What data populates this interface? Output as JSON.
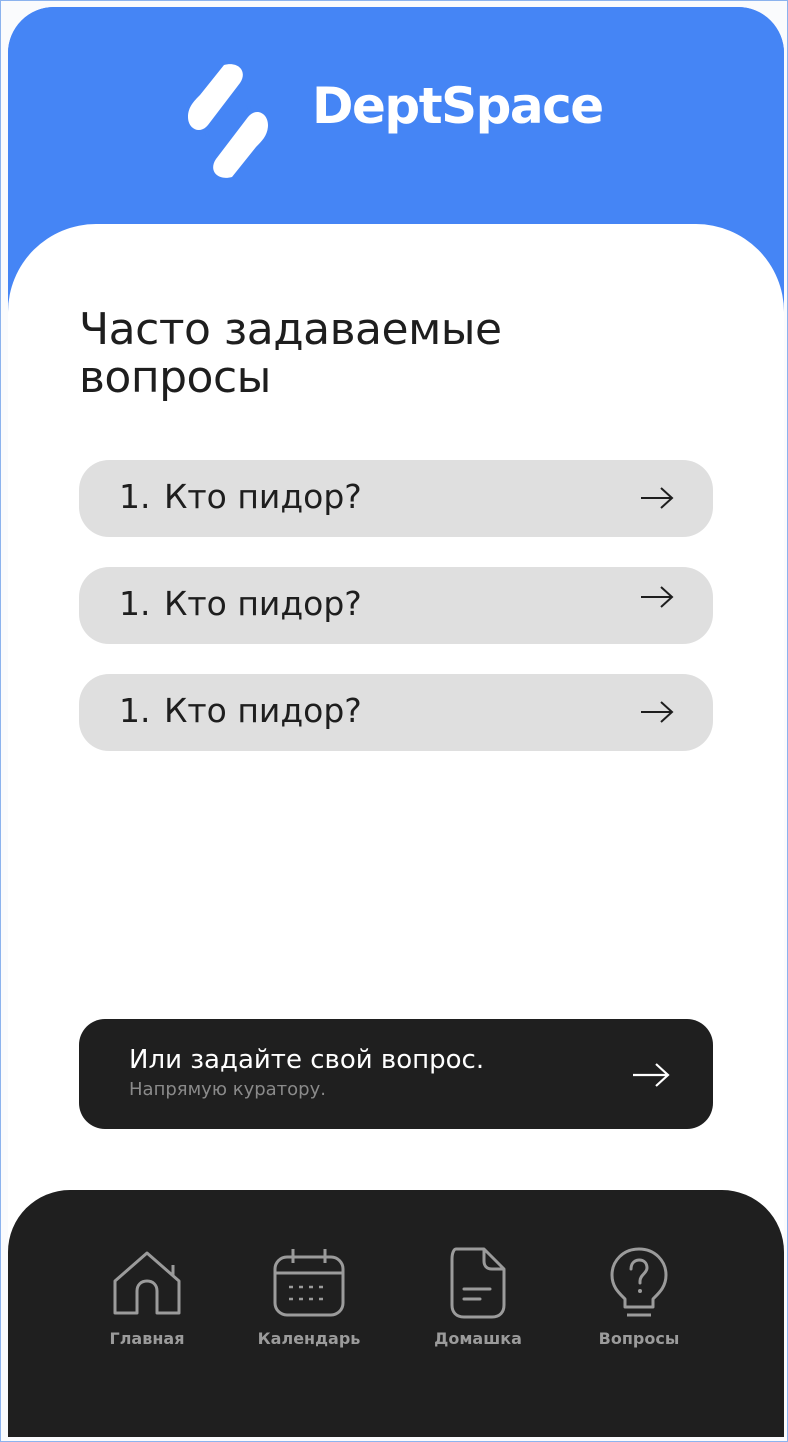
{
  "app": {
    "brand_name": "DeptSpace",
    "logo_icon": "deptspace-logo-icon",
    "accent_color": "#4585f5",
    "dark_color": "#1f1f1f"
  },
  "page": {
    "title": "Часто задаваемые вопросы"
  },
  "faq": {
    "items": [
      {
        "number": "1.",
        "question": "Кто пидор?",
        "icon": "arrow-right-icon"
      },
      {
        "number": "1.",
        "question": "Кто пидор?",
        "icon": "arrow-right-icon"
      },
      {
        "number": "1.",
        "question": "Кто пидор?",
        "icon": "arrow-right-icon"
      }
    ]
  },
  "ask": {
    "title": "Или задайте свой вопрос.",
    "subtitle": "Напрямую куратору.",
    "icon": "arrow-right-icon"
  },
  "nav": {
    "items": [
      {
        "label": "Главная",
        "icon": "home-icon"
      },
      {
        "label": "Календарь",
        "icon": "calendar-icon"
      },
      {
        "label": "Домашка",
        "icon": "document-icon"
      },
      {
        "label": "Вопросы",
        "icon": "lightbulb-question-icon"
      }
    ]
  }
}
